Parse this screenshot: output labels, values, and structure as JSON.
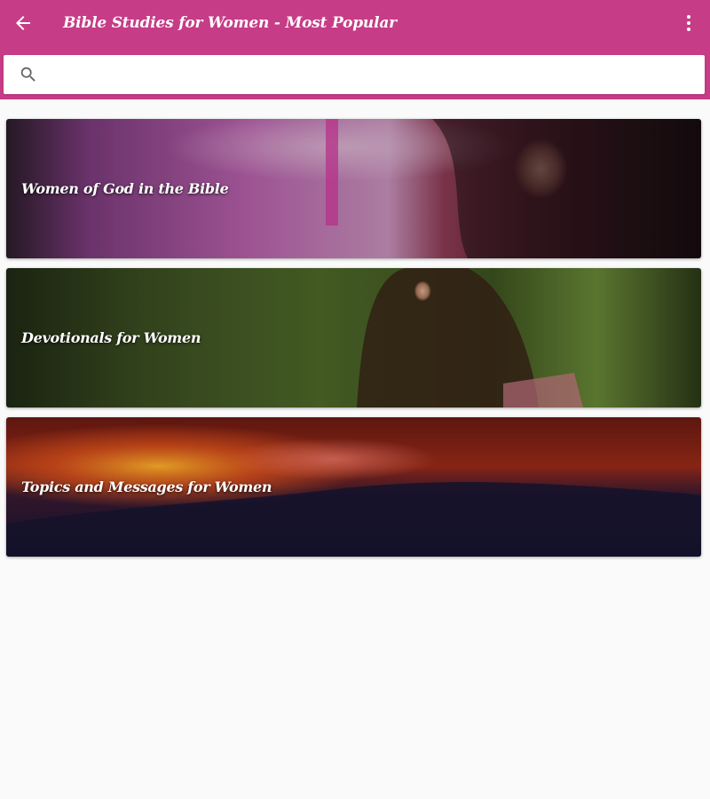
{
  "appbar": {
    "title": "Bible Studies for Women - Most Popular",
    "color": "#c63c87",
    "back_icon": "arrow-left-icon",
    "menu_icon": "more-vert-icon"
  },
  "search": {
    "value": "",
    "placeholder": "",
    "icon": "search-icon"
  },
  "cards": [
    {
      "label": "Women of God in the Bible"
    },
    {
      "label": "Devotionals for Women"
    },
    {
      "label": "Topics and Messages for Women"
    }
  ]
}
